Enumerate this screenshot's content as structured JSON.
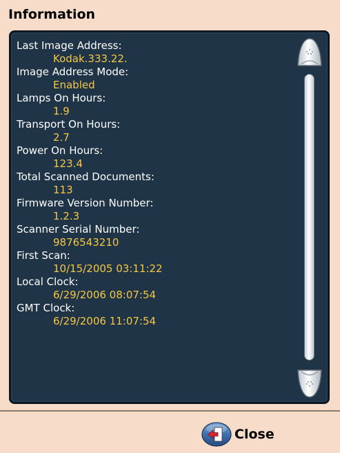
{
  "dialog": {
    "title": "Information",
    "close_label": "Close"
  },
  "info": [
    {
      "label": "Last Image Address:",
      "value": "Kodak.333.22."
    },
    {
      "label": "Image Address Mode:",
      "value": "Enabled"
    },
    {
      "label": "Lamps On Hours:",
      "value": "1.9"
    },
    {
      "label": "Transport On Hours:",
      "value": "2.7"
    },
    {
      "label": "Power On Hours:",
      "value": "123.4"
    },
    {
      "label": "Total Scanned Documents:",
      "value": "113"
    },
    {
      "label": "Firmware Version Number:",
      "value": "1.2.3"
    },
    {
      "label": "Scanner Serial Number:",
      "value": "9876543210"
    },
    {
      "label": "First Scan:",
      "value": "10/15/2005 03:11:22"
    },
    {
      "label": "Local Clock:",
      "value": "6/29/2006 08:07:54"
    },
    {
      "label": "GMT Clock:",
      "value": "6/29/2006 11:07:54"
    }
  ],
  "colors": {
    "background": "#f6dcc9",
    "panel": "#1f3447",
    "label_text": "#ffffff",
    "value_text": "#f6c744"
  },
  "icons": {
    "scroll_up": "scroll-up-arrow-icon",
    "scroll_down": "scroll-down-arrow-icon",
    "close": "close-door-arrow-icon"
  }
}
